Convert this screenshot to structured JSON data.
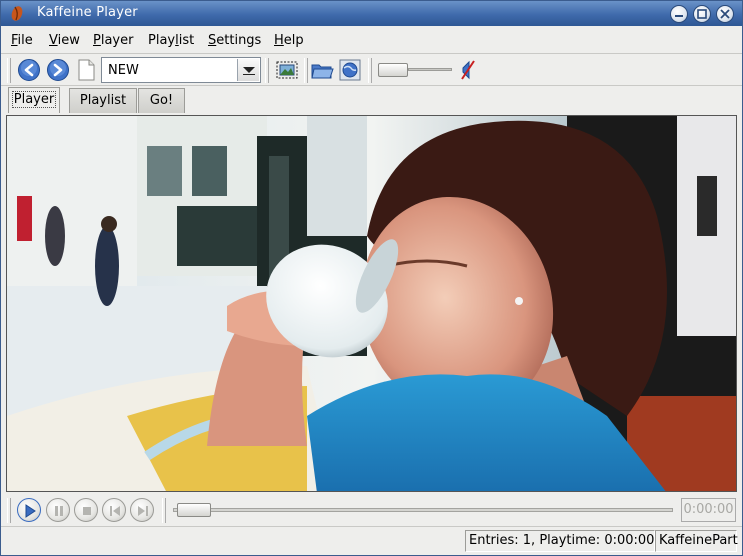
{
  "window": {
    "title": "Kaffeine Player"
  },
  "menu": [
    {
      "label": "File",
      "accel": "F",
      "rest": "ile"
    },
    {
      "label": "View",
      "accel": "V",
      "rest": "iew"
    },
    {
      "label": "Player",
      "accel": "P",
      "rest": "layer"
    },
    {
      "label": "Playlist",
      "pre": "Play",
      "accel": "l",
      "rest": "ist"
    },
    {
      "label": "Settings",
      "accel": "S",
      "rest": "ettings"
    },
    {
      "label": "Help",
      "accel": "H",
      "rest": "elp"
    }
  ],
  "toolbar": {
    "playlist_combo_value": "NEW",
    "icons": [
      "back-icon",
      "forward-icon",
      "new-document-icon",
      "fullscreen-icon",
      "open-folder-icon",
      "open-url-icon",
      "volume-icon"
    ],
    "volume_level": 0.0
  },
  "tabs": [
    {
      "label": "Player",
      "active": true
    },
    {
      "label": "Playlist",
      "active": false
    },
    {
      "label": "Go!",
      "active": false
    }
  ],
  "controls": {
    "icons": [
      "play-icon",
      "pause-icon",
      "stop-icon",
      "previous-icon",
      "next-icon"
    ],
    "seek_position": 0.0,
    "time": "0:00:00"
  },
  "status": {
    "entries": "Entries: 1, Playtime: 0:00:00",
    "part": "KaffeinePart"
  },
  "colors": {
    "titlebar": "#3f6aab",
    "accent_blue": "#3a6cc0",
    "window_bg": "#eeeeec"
  }
}
